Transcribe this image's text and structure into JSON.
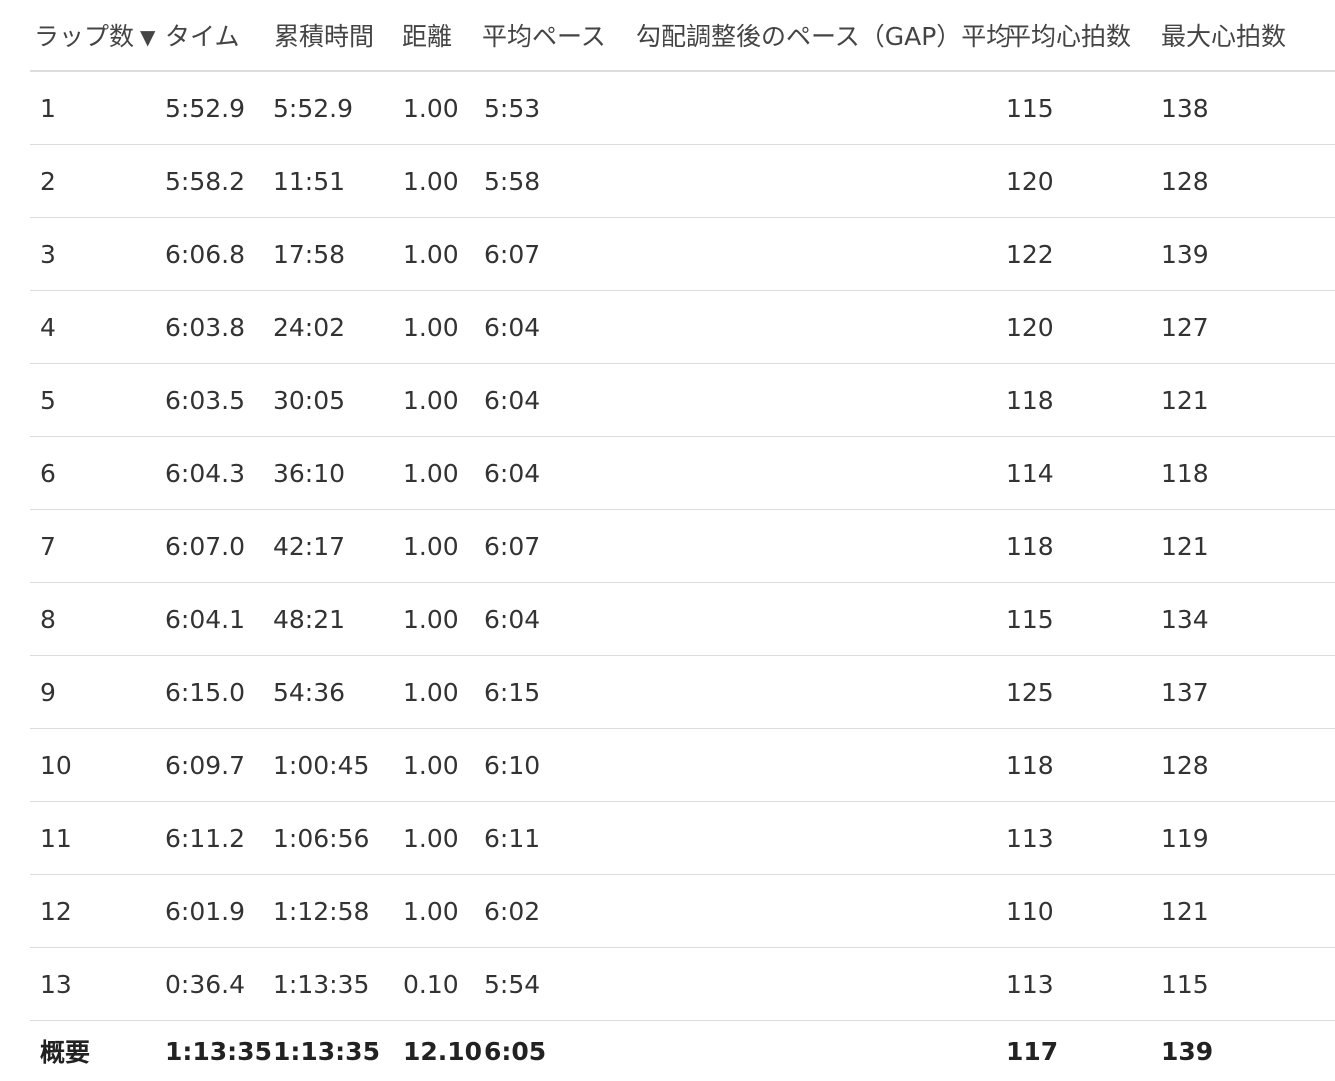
{
  "columns": {
    "lap": "ラップ数",
    "time": "タイム",
    "cumulative": "累積時間",
    "distance": "距離",
    "avg_pace": "平均ペース",
    "gap_pace": "勾配調整後のペース（GAP）平均",
    "avg_hr": "平均心拍数",
    "max_hr": "最大心拍数"
  },
  "sort_indicator": "▼",
  "laps": [
    {
      "lap": "1",
      "time": "5:52.9",
      "cumulative": "5:52.9",
      "distance": "1.00",
      "avg_pace": "5:53",
      "gap_pace": "",
      "avg_hr": "115",
      "max_hr": "138"
    },
    {
      "lap": "2",
      "time": "5:58.2",
      "cumulative": "11:51",
      "distance": "1.00",
      "avg_pace": "5:58",
      "gap_pace": "",
      "avg_hr": "120",
      "max_hr": "128"
    },
    {
      "lap": "3",
      "time": "6:06.8",
      "cumulative": "17:58",
      "distance": "1.00",
      "avg_pace": "6:07",
      "gap_pace": "",
      "avg_hr": "122",
      "max_hr": "139"
    },
    {
      "lap": "4",
      "time": "6:03.8",
      "cumulative": "24:02",
      "distance": "1.00",
      "avg_pace": "6:04",
      "gap_pace": "",
      "avg_hr": "120",
      "max_hr": "127"
    },
    {
      "lap": "5",
      "time": "6:03.5",
      "cumulative": "30:05",
      "distance": "1.00",
      "avg_pace": "6:04",
      "gap_pace": "",
      "avg_hr": "118",
      "max_hr": "121"
    },
    {
      "lap": "6",
      "time": "6:04.3",
      "cumulative": "36:10",
      "distance": "1.00",
      "avg_pace": "6:04",
      "gap_pace": "",
      "avg_hr": "114",
      "max_hr": "118"
    },
    {
      "lap": "7",
      "time": "6:07.0",
      "cumulative": "42:17",
      "distance": "1.00",
      "avg_pace": "6:07",
      "gap_pace": "",
      "avg_hr": "118",
      "max_hr": "121"
    },
    {
      "lap": "8",
      "time": "6:04.1",
      "cumulative": "48:21",
      "distance": "1.00",
      "avg_pace": "6:04",
      "gap_pace": "",
      "avg_hr": "115",
      "max_hr": "134"
    },
    {
      "lap": "9",
      "time": "6:15.0",
      "cumulative": "54:36",
      "distance": "1.00",
      "avg_pace": "6:15",
      "gap_pace": "",
      "avg_hr": "125",
      "max_hr": "137"
    },
    {
      "lap": "10",
      "time": "6:09.7",
      "cumulative": "1:00:45",
      "distance": "1.00",
      "avg_pace": "6:10",
      "gap_pace": "",
      "avg_hr": "118",
      "max_hr": "128"
    },
    {
      "lap": "11",
      "time": "6:11.2",
      "cumulative": "1:06:56",
      "distance": "1.00",
      "avg_pace": "6:11",
      "gap_pace": "",
      "avg_hr": "113",
      "max_hr": "119"
    },
    {
      "lap": "12",
      "time": "6:01.9",
      "cumulative": "1:12:58",
      "distance": "1.00",
      "avg_pace": "6:02",
      "gap_pace": "",
      "avg_hr": "110",
      "max_hr": "121"
    },
    {
      "lap": "13",
      "time": "0:36.4",
      "cumulative": "1:13:35",
      "distance": "0.10",
      "avg_pace": "5:54",
      "gap_pace": "",
      "avg_hr": "113",
      "max_hr": "115"
    }
  ],
  "summary": {
    "lap": "概要",
    "time": "1:13:35",
    "cumulative": "1:13:35",
    "distance": "12.10",
    "avg_pace": "6:05",
    "gap_pace": "",
    "avg_hr": "117",
    "max_hr": "139"
  }
}
